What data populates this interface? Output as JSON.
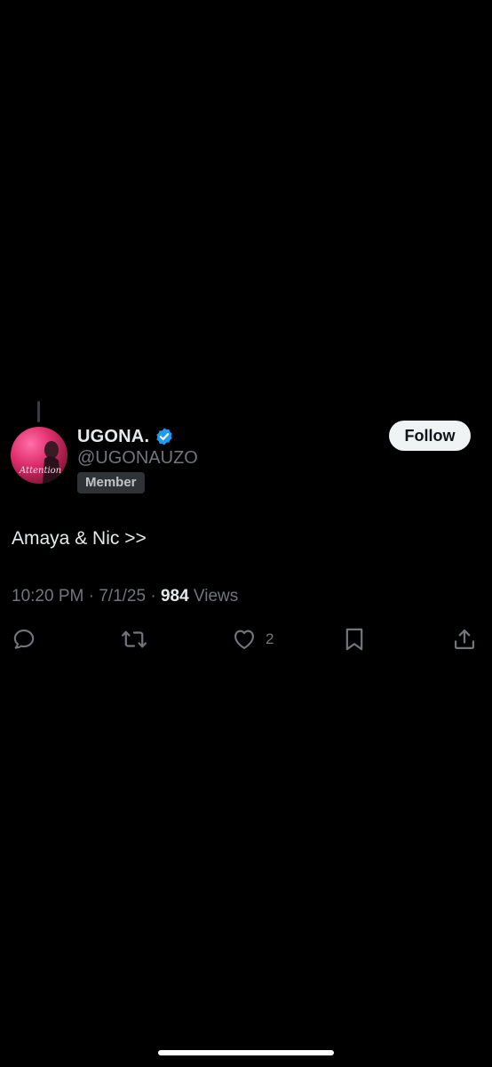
{
  "tweet": {
    "author": {
      "display_name": "UGONA.",
      "handle": "@UGONAUZO",
      "verified_icon": "verified-badge-icon",
      "badge": "Member",
      "avatar_text": "Attention"
    },
    "follow_label": "Follow",
    "text": "Amaya & Nic >>",
    "time": "10:20 PM",
    "date": "7/1/25",
    "separator": "·",
    "views_count": "984",
    "views_label": "Views",
    "actions": {
      "reply_icon": "reply-icon",
      "retweet_icon": "retweet-icon",
      "like_icon": "heart-icon",
      "like_count": "2",
      "bookmark_icon": "bookmark-icon",
      "share_icon": "share-icon"
    }
  },
  "colors": {
    "background": "#000000",
    "primary_text": "#e7e9ea",
    "secondary_text": "#71767b",
    "verified_blue": "#1d9bf0",
    "follow_bg": "#eff3f4"
  }
}
